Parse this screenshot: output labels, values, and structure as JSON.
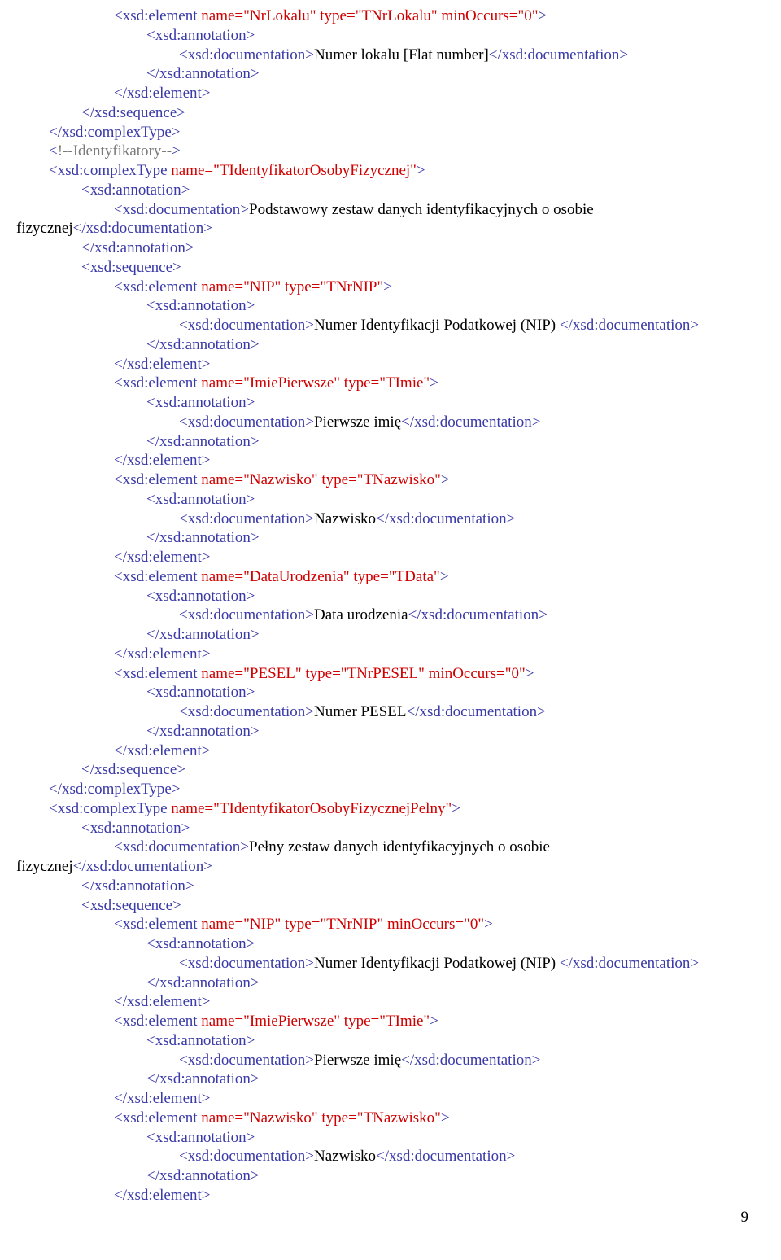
{
  "page_number": "9",
  "lines": [
    {
      "indent": 3,
      "spans": [
        {
          "c": "tag",
          "t": "<xsd:element "
        },
        {
          "c": "attr",
          "t": "name=\"NrLokalu\" type=\"TNrLokalu\" minOccurs=\"0\""
        },
        {
          "c": "tag",
          "t": ">"
        }
      ]
    },
    {
      "indent": 4,
      "spans": [
        {
          "c": "tag",
          "t": "<xsd:annotation>"
        }
      ]
    },
    {
      "indent": 5,
      "spans": [
        {
          "c": "tag",
          "t": "<xsd:documentation>"
        },
        {
          "c": "text",
          "t": "Numer lokalu [Flat number]"
        },
        {
          "c": "tag",
          "t": "</xsd:documentation>"
        }
      ]
    },
    {
      "indent": 4,
      "spans": [
        {
          "c": "tag",
          "t": "</xsd:annotation>"
        }
      ]
    },
    {
      "indent": 3,
      "spans": [
        {
          "c": "tag",
          "t": "</xsd:element>"
        }
      ]
    },
    {
      "indent": 2,
      "spans": [
        {
          "c": "tag",
          "t": "</xsd:sequence>"
        }
      ]
    },
    {
      "indent": 1,
      "spans": [
        {
          "c": "tag",
          "t": "</xsd:complexType>"
        }
      ]
    },
    {
      "indent": 1,
      "spans": [
        {
          "c": "tag",
          "t": "<"
        },
        {
          "c": "comm",
          "t": "!--Identyfikatory--"
        },
        {
          "c": "tag",
          "t": ">"
        }
      ]
    },
    {
      "indent": 1,
      "spans": [
        {
          "c": "tag",
          "t": "<xsd:complexType "
        },
        {
          "c": "attr",
          "t": "name=\"TIdentyfikatorOsobyFizycznej\""
        },
        {
          "c": "tag",
          "t": ">"
        }
      ]
    },
    {
      "indent": 2,
      "spans": [
        {
          "c": "tag",
          "t": "<xsd:annotation>"
        }
      ]
    },
    {
      "indent": 3,
      "spans": [
        {
          "c": "tag",
          "t": "<xsd:documentation>"
        },
        {
          "c": "text",
          "t": "Podstawowy zestaw danych identyfikacyjnych o osobie"
        }
      ]
    },
    {
      "indent": 0,
      "spans": [
        {
          "c": "text",
          "t": "fizycznej"
        },
        {
          "c": "tag",
          "t": "</xsd:documentation>"
        }
      ]
    },
    {
      "indent": 2,
      "spans": [
        {
          "c": "tag",
          "t": "</xsd:annotation>"
        }
      ]
    },
    {
      "indent": 2,
      "spans": [
        {
          "c": "tag",
          "t": "<xsd:sequence>"
        }
      ]
    },
    {
      "indent": 3,
      "spans": [
        {
          "c": "tag",
          "t": "<xsd:element "
        },
        {
          "c": "attr",
          "t": "name=\"NIP\" type=\"TNrNIP\""
        },
        {
          "c": "tag",
          "t": ">"
        }
      ]
    },
    {
      "indent": 4,
      "spans": [
        {
          "c": "tag",
          "t": "<xsd:annotation>"
        }
      ]
    },
    {
      "indent": 5,
      "spans": [
        {
          "c": "tag",
          "t": "<xsd:documentation>"
        },
        {
          "c": "text",
          "t": "Numer Identyfikacji Podatkowej (NIP) "
        },
        {
          "c": "tag",
          "t": "</xsd:documentation>"
        }
      ]
    },
    {
      "indent": 4,
      "spans": [
        {
          "c": "tag",
          "t": "</xsd:annotation>"
        }
      ]
    },
    {
      "indent": 3,
      "spans": [
        {
          "c": "tag",
          "t": "</xsd:element>"
        }
      ]
    },
    {
      "indent": 3,
      "spans": [
        {
          "c": "tag",
          "t": "<xsd:element "
        },
        {
          "c": "attr",
          "t": "name=\"ImiePierwsze\" type=\"TImie\""
        },
        {
          "c": "tag",
          "t": ">"
        }
      ]
    },
    {
      "indent": 4,
      "spans": [
        {
          "c": "tag",
          "t": "<xsd:annotation>"
        }
      ]
    },
    {
      "indent": 5,
      "spans": [
        {
          "c": "tag",
          "t": "<xsd:documentation>"
        },
        {
          "c": "text",
          "t": "Pierwsze imię"
        },
        {
          "c": "tag",
          "t": "</xsd:documentation>"
        }
      ]
    },
    {
      "indent": 4,
      "spans": [
        {
          "c": "tag",
          "t": "</xsd:annotation>"
        }
      ]
    },
    {
      "indent": 3,
      "spans": [
        {
          "c": "tag",
          "t": "</xsd:element>"
        }
      ]
    },
    {
      "indent": 3,
      "spans": [
        {
          "c": "tag",
          "t": "<xsd:element "
        },
        {
          "c": "attr",
          "t": "name=\"Nazwisko\" type=\"TNazwisko\""
        },
        {
          "c": "tag",
          "t": ">"
        }
      ]
    },
    {
      "indent": 4,
      "spans": [
        {
          "c": "tag",
          "t": "<xsd:annotation>"
        }
      ]
    },
    {
      "indent": 5,
      "spans": [
        {
          "c": "tag",
          "t": "<xsd:documentation>"
        },
        {
          "c": "text",
          "t": "Nazwisko"
        },
        {
          "c": "tag",
          "t": "</xsd:documentation>"
        }
      ]
    },
    {
      "indent": 4,
      "spans": [
        {
          "c": "tag",
          "t": "</xsd:annotation>"
        }
      ]
    },
    {
      "indent": 3,
      "spans": [
        {
          "c": "tag",
          "t": "</xsd:element>"
        }
      ]
    },
    {
      "indent": 3,
      "spans": [
        {
          "c": "tag",
          "t": "<xsd:element "
        },
        {
          "c": "attr",
          "t": "name=\"DataUrodzenia\" type=\"TData\""
        },
        {
          "c": "tag",
          "t": ">"
        }
      ]
    },
    {
      "indent": 4,
      "spans": [
        {
          "c": "tag",
          "t": "<xsd:annotation>"
        }
      ]
    },
    {
      "indent": 5,
      "spans": [
        {
          "c": "tag",
          "t": "<xsd:documentation>"
        },
        {
          "c": "text",
          "t": "Data urodzenia"
        },
        {
          "c": "tag",
          "t": "</xsd:documentation>"
        }
      ]
    },
    {
      "indent": 4,
      "spans": [
        {
          "c": "tag",
          "t": "</xsd:annotation>"
        }
      ]
    },
    {
      "indent": 3,
      "spans": [
        {
          "c": "tag",
          "t": "</xsd:element>"
        }
      ]
    },
    {
      "indent": 3,
      "spans": [
        {
          "c": "tag",
          "t": "<xsd:element "
        },
        {
          "c": "attr",
          "t": "name=\"PESEL\" type=\"TNrPESEL\" minOccurs=\"0\""
        },
        {
          "c": "tag",
          "t": ">"
        }
      ]
    },
    {
      "indent": 4,
      "spans": [
        {
          "c": "tag",
          "t": "<xsd:annotation>"
        }
      ]
    },
    {
      "indent": 5,
      "spans": [
        {
          "c": "tag",
          "t": "<xsd:documentation>"
        },
        {
          "c": "text",
          "t": "Numer PESEL"
        },
        {
          "c": "tag",
          "t": "</xsd:documentation>"
        }
      ]
    },
    {
      "indent": 4,
      "spans": [
        {
          "c": "tag",
          "t": "</xsd:annotation>"
        }
      ]
    },
    {
      "indent": 3,
      "spans": [
        {
          "c": "tag",
          "t": "</xsd:element>"
        }
      ]
    },
    {
      "indent": 2,
      "spans": [
        {
          "c": "tag",
          "t": "</xsd:sequence>"
        }
      ]
    },
    {
      "indent": 1,
      "spans": [
        {
          "c": "tag",
          "t": "</xsd:complexType>"
        }
      ]
    },
    {
      "indent": 1,
      "spans": [
        {
          "c": "tag",
          "t": "<xsd:complexType "
        },
        {
          "c": "attr",
          "t": "name=\"TIdentyfikatorOsobyFizycznejPelny\""
        },
        {
          "c": "tag",
          "t": ">"
        }
      ]
    },
    {
      "indent": 2,
      "spans": [
        {
          "c": "tag",
          "t": "<xsd:annotation>"
        }
      ]
    },
    {
      "indent": 3,
      "spans": [
        {
          "c": "tag",
          "t": "<xsd:documentation>"
        },
        {
          "c": "text",
          "t": "Pełny zestaw danych identyfikacyjnych o osobie"
        }
      ]
    },
    {
      "indent": 0,
      "spans": [
        {
          "c": "text",
          "t": "fizycznej"
        },
        {
          "c": "tag",
          "t": "</xsd:documentation>"
        }
      ]
    },
    {
      "indent": 2,
      "spans": [
        {
          "c": "tag",
          "t": "</xsd:annotation>"
        }
      ]
    },
    {
      "indent": 2,
      "spans": [
        {
          "c": "tag",
          "t": "<xsd:sequence>"
        }
      ]
    },
    {
      "indent": 3,
      "spans": [
        {
          "c": "tag",
          "t": "<xsd:element "
        },
        {
          "c": "attr",
          "t": "name=\"NIP\" type=\"TNrNIP\" minOccurs=\"0\""
        },
        {
          "c": "tag",
          "t": ">"
        }
      ]
    },
    {
      "indent": 4,
      "spans": [
        {
          "c": "tag",
          "t": "<xsd:annotation>"
        }
      ]
    },
    {
      "indent": 5,
      "spans": [
        {
          "c": "tag",
          "t": "<xsd:documentation>"
        },
        {
          "c": "text",
          "t": "Numer Identyfikacji Podatkowej (NIP) "
        },
        {
          "c": "tag",
          "t": "</xsd:documentation>"
        }
      ]
    },
    {
      "indent": 4,
      "spans": [
        {
          "c": "tag",
          "t": "</xsd:annotation>"
        }
      ]
    },
    {
      "indent": 3,
      "spans": [
        {
          "c": "tag",
          "t": "</xsd:element>"
        }
      ]
    },
    {
      "indent": 3,
      "spans": [
        {
          "c": "tag",
          "t": "<xsd:element "
        },
        {
          "c": "attr",
          "t": "name=\"ImiePierwsze\" type=\"TImie\""
        },
        {
          "c": "tag",
          "t": ">"
        }
      ]
    },
    {
      "indent": 4,
      "spans": [
        {
          "c": "tag",
          "t": "<xsd:annotation>"
        }
      ]
    },
    {
      "indent": 5,
      "spans": [
        {
          "c": "tag",
          "t": "<xsd:documentation>"
        },
        {
          "c": "text",
          "t": "Pierwsze imię"
        },
        {
          "c": "tag",
          "t": "</xsd:documentation>"
        }
      ]
    },
    {
      "indent": 4,
      "spans": [
        {
          "c": "tag",
          "t": "</xsd:annotation>"
        }
      ]
    },
    {
      "indent": 3,
      "spans": [
        {
          "c": "tag",
          "t": "</xsd:element>"
        }
      ]
    },
    {
      "indent": 3,
      "spans": [
        {
          "c": "tag",
          "t": "<xsd:element "
        },
        {
          "c": "attr",
          "t": "name=\"Nazwisko\" type=\"TNazwisko\""
        },
        {
          "c": "tag",
          "t": ">"
        }
      ]
    },
    {
      "indent": 4,
      "spans": [
        {
          "c": "tag",
          "t": "<xsd:annotation>"
        }
      ]
    },
    {
      "indent": 5,
      "spans": [
        {
          "c": "tag",
          "t": "<xsd:documentation>"
        },
        {
          "c": "text",
          "t": "Nazwisko"
        },
        {
          "c": "tag",
          "t": "</xsd:documentation>"
        }
      ]
    },
    {
      "indent": 4,
      "spans": [
        {
          "c": "tag",
          "t": "</xsd:annotation>"
        }
      ]
    },
    {
      "indent": 3,
      "spans": [
        {
          "c": "tag",
          "t": "</xsd:element>"
        }
      ]
    }
  ]
}
